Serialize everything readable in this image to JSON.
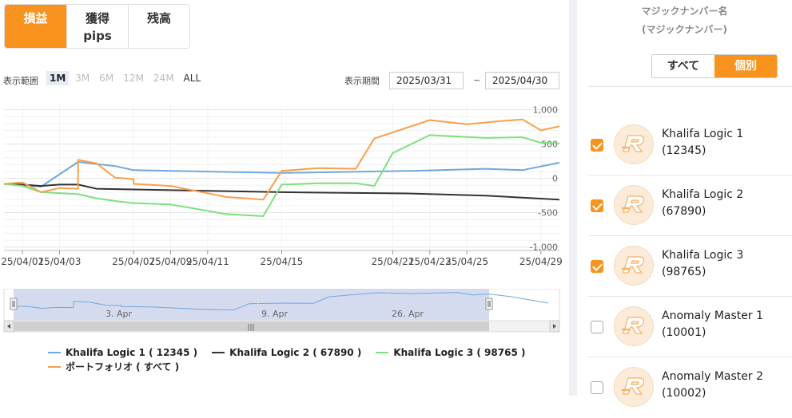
{
  "tabs": [
    {
      "label": "損益",
      "active": true
    },
    {
      "label": "獲得\npips",
      "active": false
    },
    {
      "label": "残高",
      "active": false
    }
  ],
  "range": {
    "label": "表示範囲",
    "buttons": [
      "1M",
      "3M",
      "6M",
      "12M",
      "24M",
      "ALL"
    ],
    "active": "1M"
  },
  "period": {
    "label": "表示期間",
    "start": "2025/03/31",
    "end": "2025/04/30",
    "separator": "~"
  },
  "chart_data": {
    "type": "line",
    "x_ticks": [
      "25/04/01",
      "25/04/03",
      "25/04/07",
      "25/04/09",
      "25/04/11",
      "25/04/15",
      "25/04/21",
      "25/04/23",
      "25/04/25",
      "25/04/29"
    ],
    "y_ticks": [
      "1,000",
      "500",
      "0",
      "-500",
      "-1,000"
    ],
    "ylim": [
      -1050,
      1100
    ],
    "grid": true,
    "legend_position": "bottom",
    "series": [
      {
        "name": "Khalifa Logic 1 ( 12345 )",
        "color": "#6fa8dc",
        "points": [
          [
            "03/31",
            -80
          ],
          [
            "04/02",
            -120
          ],
          [
            "04/04",
            240
          ],
          [
            "04/06",
            180
          ],
          [
            "04/07",
            120
          ],
          [
            "04/15",
            80
          ],
          [
            "04/22",
            110
          ],
          [
            "04/26",
            140
          ],
          [
            "04/28",
            120
          ],
          [
            "04/30",
            230
          ]
        ]
      },
      {
        "name": "Khalifa Logic 2 ( 67890 )",
        "color": "#333333",
        "points": [
          [
            "03/31",
            -80
          ],
          [
            "04/01",
            -90
          ],
          [
            "04/02",
            -110
          ],
          [
            "04/03",
            -90
          ],
          [
            "04/04",
            -90
          ],
          [
            "04/05",
            -150
          ],
          [
            "04/15",
            -200
          ],
          [
            "04/22",
            -220
          ],
          [
            "04/26",
            -250
          ],
          [
            "04/30",
            -310
          ]
        ]
      },
      {
        "name": "Khalifa Logic 3 ( 98765 )",
        "color": "#7ee07e",
        "points": [
          [
            "03/31",
            -80
          ],
          [
            "04/01",
            -110
          ],
          [
            "04/02",
            -200
          ],
          [
            "04/04",
            -230
          ],
          [
            "04/05",
            -290
          ],
          [
            "04/06",
            -330
          ],
          [
            "04/07",
            -360
          ],
          [
            "04/09",
            -380
          ],
          [
            "04/12",
            -520
          ],
          [
            "04/14",
            -550
          ],
          [
            "04/15",
            -90
          ],
          [
            "04/17",
            -70
          ],
          [
            "04/19",
            -70
          ],
          [
            "04/20",
            -110
          ],
          [
            "04/21",
            370
          ],
          [
            "04/23",
            630
          ],
          [
            "04/26",
            590
          ],
          [
            "04/28",
            600
          ],
          [
            "04/29",
            520
          ],
          [
            "04/30",
            510
          ]
        ]
      },
      {
        "name": "ポートフォリオ ( すべて )",
        "color": "#f7a04b",
        "points": [
          [
            "03/31",
            -80
          ],
          [
            "04/01",
            -60
          ],
          [
            "04/02",
            -200
          ],
          [
            "04/03",
            -140
          ],
          [
            "04/04",
            -150
          ],
          [
            "04/04",
            270
          ],
          [
            "04/05",
            220
          ],
          [
            "04/06",
            10
          ],
          [
            "04/07",
            -10
          ],
          [
            "04/07",
            -80
          ],
          [
            "04/09",
            -110
          ],
          [
            "04/12",
            -270
          ],
          [
            "04/14",
            -310
          ],
          [
            "04/15",
            110
          ],
          [
            "04/17",
            150
          ],
          [
            "04/19",
            140
          ],
          [
            "04/20",
            580
          ],
          [
            "04/23",
            850
          ],
          [
            "04/25",
            790
          ],
          [
            "04/27",
            840
          ],
          [
            "04/28",
            860
          ],
          [
            "04/29",
            700
          ],
          [
            "04/30",
            760
          ]
        ]
      }
    ],
    "navigator": {
      "labels": [
        "3. Apr",
        "9. Apr",
        "26. Apr"
      ],
      "scroll_label": "|||"
    }
  },
  "sidebar": {
    "title_line1": "マジックナンバー名",
    "title_line2": "(マジックナンバー)",
    "toggle": [
      "すべて",
      "個別"
    ],
    "toggle_active": "個別",
    "eas": [
      {
        "name": "Khalifa Logic 1",
        "number": "(12345)",
        "checked": true
      },
      {
        "name": "Khalifa Logic 2",
        "number": "(67890)",
        "checked": true
      },
      {
        "name": "Khalifa Logic 3",
        "number": "(98765)",
        "checked": true
      },
      {
        "name": "Anomaly Master 1",
        "number": "(10001)",
        "checked": false
      },
      {
        "name": "Anomaly Master 2",
        "number": "(10002)",
        "checked": false
      }
    ]
  },
  "colors": {
    "accent": "#f7931e",
    "avatar_bg": "#fcebd8"
  }
}
